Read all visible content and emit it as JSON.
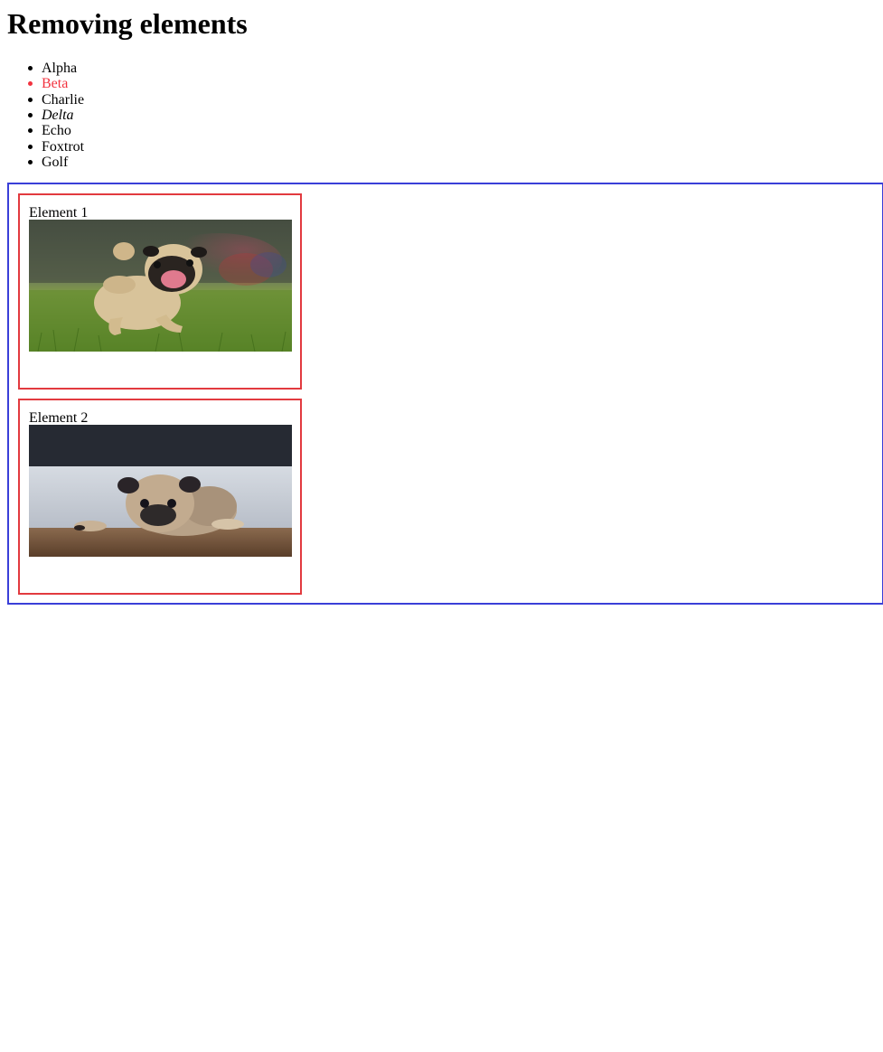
{
  "page": {
    "heading": "Removing elements"
  },
  "list": {
    "items": [
      {
        "label": "Alpha",
        "style": "normal"
      },
      {
        "label": "Beta",
        "style": "red"
      },
      {
        "label": "Charlie",
        "style": "normal"
      },
      {
        "label": "Delta",
        "style": "italic"
      },
      {
        "label": "Echo",
        "style": "normal"
      },
      {
        "label": "Foxtrot",
        "style": "normal"
      },
      {
        "label": "Golf",
        "style": "normal"
      }
    ]
  },
  "elements": [
    {
      "label": "Element 1",
      "image": "pug-running-on-grass"
    },
    {
      "label": "Element 2",
      "image": "pug-lying-on-floor"
    }
  ],
  "colors": {
    "container_border": "#3a3fd8",
    "element_border": "#e23a3f",
    "highlight_text": "#f2333f"
  }
}
